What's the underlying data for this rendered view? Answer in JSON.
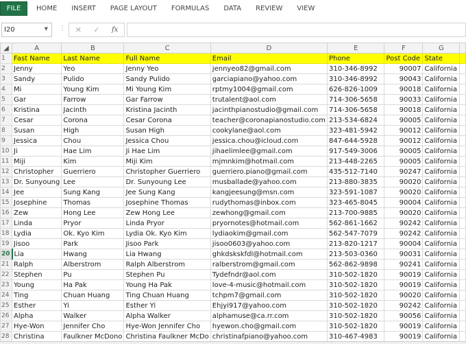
{
  "ribbon": {
    "tabs": [
      "FILE",
      "HOME",
      "INSERT",
      "PAGE LAYOUT",
      "FORMULAS",
      "DATA",
      "REVIEW",
      "VIEW"
    ]
  },
  "formula_bar": {
    "name_box": "I20",
    "cancel": "✕",
    "enter": "✓",
    "fx": "fx",
    "value": ""
  },
  "columns": [
    "A",
    "B",
    "C",
    "D",
    "E",
    "F",
    "G",
    ""
  ],
  "selected_row": 20,
  "header_row": [
    "Fast Name",
    "Last Name",
    "Full Name",
    "Email",
    "Phone",
    "Post Code",
    "State"
  ],
  "rows": [
    [
      "Jenny",
      "Yeo",
      "Jenny Yeo",
      "jennyeo82@gmail.com",
      "310-346-8992",
      "90007",
      "California"
    ],
    [
      "Sandy",
      "Pulido",
      "Sandy Pulido",
      "garciapiano@yahoo.com",
      "310-346-8992",
      "90043",
      "California"
    ],
    [
      "Mi",
      "Young Kim",
      "Mi Young Kim",
      "rptmy1004@gmail.com",
      "626-826-1009",
      "90018",
      "California"
    ],
    [
      "Gar",
      "Farrow",
      "Gar Farrow",
      "trutalent@aol.com",
      "714-306-5658",
      "90033",
      "California"
    ],
    [
      "Kristina",
      "Jacinth",
      "Kristina Jacinth",
      "jacinthpianostudio@gmail.com",
      "714-306-5658",
      "90018",
      "California"
    ],
    [
      "Cesar",
      "Corona",
      "Cesar Corona",
      "teacher@coronapianostudio.com",
      "213-534-6824",
      "90005",
      "California"
    ],
    [
      "Susan",
      "High",
      "Susan High",
      "cookylane@aol.com",
      "323-481-5942",
      "90012",
      "California"
    ],
    [
      "Jessica",
      "Chou",
      "Jessica Chou",
      "jessica.chou@icloud.com",
      "847-644-5928",
      "90012",
      "California"
    ],
    [
      "Ji",
      "Hae Lim",
      "Ji Hae Lim",
      "jihaelimlee@gmail.com",
      "917-549-3006",
      "90005",
      "California"
    ],
    [
      "Miji",
      "Kim",
      "Miji Kim",
      "mjmnkim@hotmail.com",
      "213-448-2265",
      "90005",
      "California"
    ],
    [
      "Christopher",
      "Guerriero",
      "Christopher Guerriero",
      "guerriero.piano@gmail.com",
      "435-512-7140",
      "90247",
      "California"
    ],
    [
      "Dr. Sunyoung",
      "Lee",
      "Dr. Sunyoung Lee",
      "musballade@yahoo.com",
      "213-880-3835",
      "90020",
      "California"
    ],
    [
      "Jee",
      "Sung Kang",
      "Jee Sung Kang",
      "kangjeesung@msn.com",
      "323-591-1087",
      "90020",
      "California"
    ],
    [
      "Josephine",
      "Thomas",
      "Josephine Thomas",
      "rudythomas@inbox.com",
      "323-465-8045",
      "90004",
      "California"
    ],
    [
      "Zew",
      "Hong Lee",
      "Zew Hong Lee",
      "zewhong@gmail.com",
      "213-700-9885",
      "90020",
      "California"
    ],
    [
      "Linda",
      "Pryor",
      "Linda Pryor",
      "pryornotes@hotmail.com",
      "562-861-1662",
      "90242",
      "California"
    ],
    [
      "Lydia",
      "Ok. Kyo Kim",
      "Lydia Ok. Kyo Kim",
      "lydiaokim@gmail.com",
      "562-547-7079",
      "90242",
      "California"
    ],
    [
      "Jisoo",
      "Park",
      "Jisoo Park",
      "jisoo0603@yahoo.com",
      "213-820-1217",
      "90004",
      "California"
    ],
    [
      "Lia",
      "Hwang",
      "Lia Hwang",
      "ghkdskskfdl@hotmail.com",
      "213-503-0360",
      "90031",
      "California"
    ],
    [
      "Ralph",
      "Alberstrom",
      "Ralph Alberstrom",
      "ralberstrom@gmail.com",
      "562-862-9898",
      "90241",
      "California"
    ],
    [
      "Stephen",
      "Pu",
      "Stephen Pu",
      "Tydefndr@aol.com",
      "310-502-1820",
      "90019",
      "California"
    ],
    [
      "Young",
      "Ha Pak",
      "Young Ha Pak",
      "love-4-music@hotmail.com",
      "310-502-1820",
      "90019",
      "California"
    ],
    [
      "Ting",
      "Chuan Huang",
      "Ting Chuan Huang",
      "tchpm7@gmail.com",
      "310-502-1820",
      "90020",
      "California"
    ],
    [
      "Esther",
      "Yi",
      "Esther Yi",
      "Ehjyi917@yahoo.com",
      "310-502-1820",
      "90242",
      "California"
    ],
    [
      "Alpha",
      "Walker",
      "Alpha Walker",
      "alphamuse@ca.rr.com",
      "310-502-1820",
      "90056",
      "California"
    ],
    [
      "Hye-Won",
      "Jennifer Cho",
      "Hye-Won Jennifer Cho",
      "hyewon.cho@gmail.com",
      "310-502-1820",
      "90019",
      "California"
    ],
    [
      "Christina",
      "Faulkner McDono",
      "Christina Faulkner McDo",
      "christinafpiano@yahoo.com",
      "310-467-4983",
      "90019",
      "California"
    ]
  ],
  "colors": {
    "file_tab": "#217346",
    "header_fill": "#ffff00"
  }
}
